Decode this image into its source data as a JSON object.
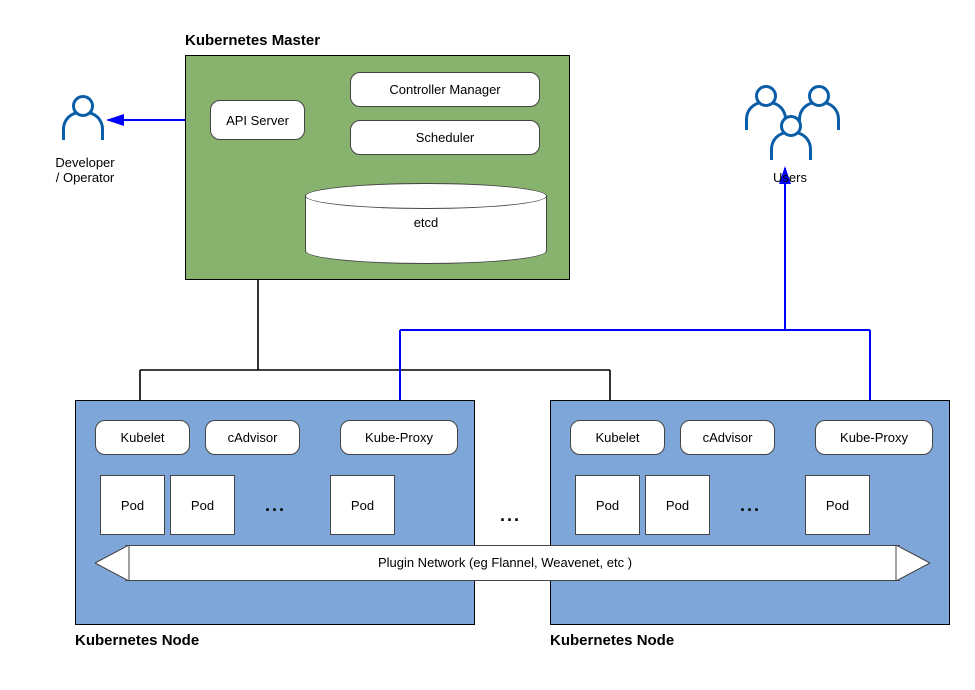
{
  "master": {
    "title": "Kubernetes Master",
    "api": "API Server",
    "controller": "Controller Manager",
    "scheduler": "Scheduler",
    "etcd": "etcd"
  },
  "node": {
    "title": "Kubernetes Node",
    "kubelet": "Kubelet",
    "cadvisor": "cAdvisor",
    "kubeproxy": "Kube-Proxy",
    "pod": "Pod",
    "ellipsis": "..."
  },
  "actors": {
    "developer": "Developer\n/ Operator",
    "users": "Users"
  },
  "network": {
    "label": "Plugin Network (eg Flannel, Weavenet, etc )"
  },
  "between_nodes_ellipsis": "..."
}
